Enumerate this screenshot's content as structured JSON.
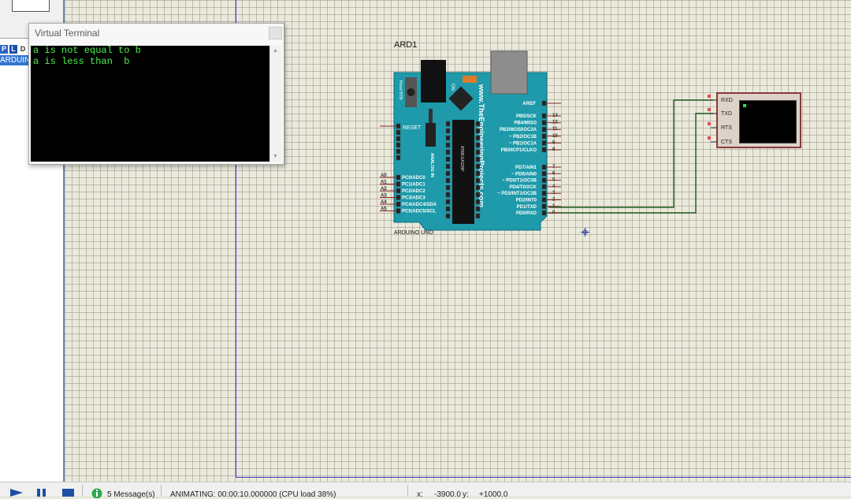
{
  "virtual_terminal": {
    "title": "Virtual Terminal",
    "lines": [
      "a is not equal to b",
      "a is less than  b"
    ]
  },
  "left_panel": {
    "badges": [
      "P",
      "L",
      "D"
    ],
    "selected_item": "ARDUINO"
  },
  "schematic": {
    "arduino_ref": "ARD1",
    "arduino_name": "ARDUINO UNO",
    "board_site": "www.TheEngineeringProjects.com",
    "chip_label": "ATMEGA328P",
    "reset_btn": "Reset BTN",
    "on_label": "ON",
    "reset_pin": "RESET",
    "analog_in": "ANALOG IN",
    "right_pins_top": [
      "AREF",
      "PB5/SCK",
      "PB4/MISO",
      "PB3/MOSI/OC2A",
      "~ PB2/OC1B",
      "~ PB1/OC1A",
      "PB0/ICP1/CLKO"
    ],
    "right_nums_top": [
      "13",
      "12",
      "11",
      "10",
      "9",
      "8"
    ],
    "right_pins_bottom": [
      "PD7/AIN1",
      "~ PD6/AIN0",
      "~ PD5/T1/OC0B",
      "PD4/T0/XCK",
      "~ PD3/INT1/OC2B",
      "PD2/INT0",
      "PD1/TXD",
      "PD0/RXD"
    ],
    "right_nums_bottom": [
      "7",
      "6",
      "5",
      "4",
      "3",
      "2",
      "1",
      "0"
    ],
    "left_pins": [
      "PC0/ADC0",
      "PC1/ADC1",
      "PC2/ADC2",
      "PC3/ADC3",
      "PC4/ADC4/SDA",
      "PC5/ADC5/SCL"
    ],
    "left_nums": [
      "A0",
      "A1",
      "A2",
      "A3",
      "A4",
      "A5"
    ],
    "terminal_pins": [
      "RXD",
      "TXD",
      "RTS",
      "CTS"
    ]
  },
  "status_bar": {
    "messages": "5 Message(s)",
    "animating": "ANIMATING: 00:00:10.000000 (CPU load 38%)",
    "x_label": "x:",
    "x_value": "-3900.0",
    "y_label": "y:",
    "y_value": "+1000.0"
  },
  "colors": {
    "board": "#1e9aaa",
    "terminal_text": "#4cf24c",
    "wire": "#1f5c1f",
    "sheet_border": "#3b3bc4"
  }
}
